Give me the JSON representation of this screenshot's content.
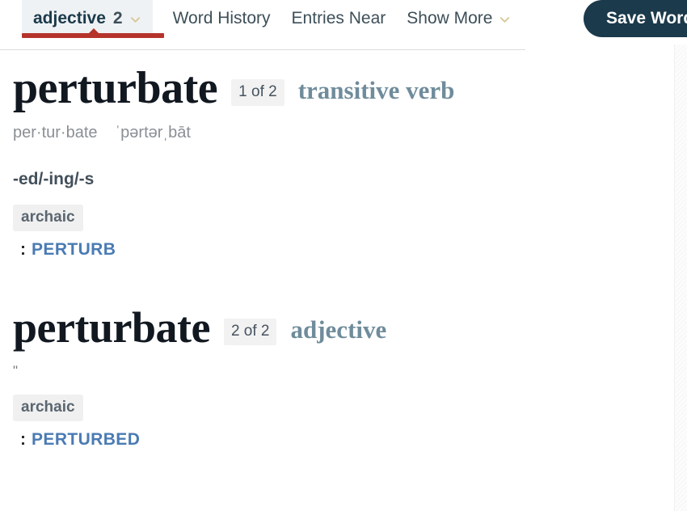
{
  "nav": {
    "tabs": [
      {
        "label": "adjective",
        "count": "2",
        "active": true,
        "has_chevron": true,
        "icon": "chevron-down-icon"
      },
      {
        "label": "Word History",
        "count": "",
        "active": false,
        "has_chevron": false,
        "icon": ""
      },
      {
        "label": "Entries Near",
        "count": "",
        "active": false,
        "has_chevron": false,
        "icon": ""
      },
      {
        "label": "Show More",
        "count": "",
        "active": false,
        "has_chevron": true,
        "icon": "chevron-down-icon"
      }
    ],
    "save_button": "Save Word",
    "accent_red": "#b5332b",
    "accent_navy": "#1b3a4b",
    "chevron_color": "#d6c99a"
  },
  "entries": [
    {
      "headword": "perturbate",
      "entry_count": "1 of 2",
      "part_of_speech": "transitive verb",
      "syllables": "per·tur·bate",
      "pronunciation": "ˈpərtərˌbāt",
      "inflections": "-ed/-ing/-s",
      "ditto": "",
      "label": "archaic",
      "def_colon": ":",
      "def_link": "PERTURB"
    },
    {
      "headword": "perturbate",
      "entry_count": "2 of 2",
      "part_of_speech": "adjective",
      "syllables": "",
      "pronunciation": "",
      "inflections": "",
      "ditto": "ʺ",
      "label": "archaic",
      "def_colon": ":",
      "def_link": "PERTURBED"
    }
  ]
}
